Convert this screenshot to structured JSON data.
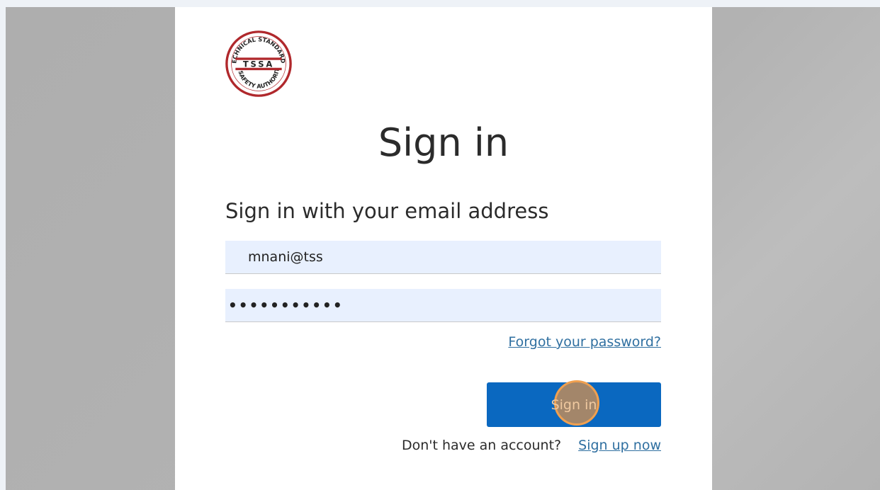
{
  "logo": {
    "arc_top": "TECHNICAL STANDARDS",
    "acronym": "TSSA",
    "arc_bottom": "& SAFETY AUTHORITY",
    "color": "#b0282c"
  },
  "page": {
    "title": "Sign in",
    "subtitle": "Sign in with your email address"
  },
  "form": {
    "email_value": "mnani@tss",
    "password_value": "•••••••••••",
    "forgot_label": "Forgot your password?",
    "submit_label": "Sign in"
  },
  "signup": {
    "prompt": "Don't have an account?",
    "link_label": "Sign up now"
  },
  "colors": {
    "primary": "#0a68c0",
    "link": "#2f6fa0",
    "input_bg": "#e8f0fe"
  }
}
